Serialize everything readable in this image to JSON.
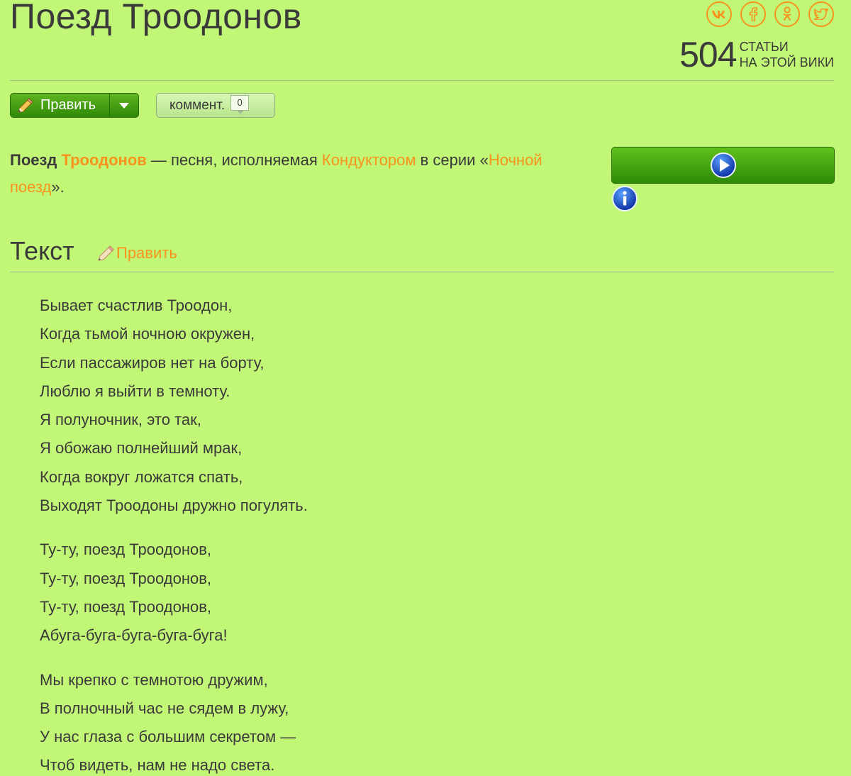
{
  "page": {
    "title": "Поезд Троодонов"
  },
  "social": [
    {
      "name": "vk",
      "label": "vk"
    },
    {
      "name": "facebook",
      "label": "f"
    },
    {
      "name": "odnoklassniki",
      "label": "ok"
    },
    {
      "name": "twitter",
      "label": "tw"
    }
  ],
  "wiki": {
    "count": "504",
    "label_line1": "СТАТЬИ",
    "label_line2": "НА ЭТОЙ ВИКИ"
  },
  "toolbar": {
    "edit_label": "Править",
    "comment_label": "коммент.",
    "comment_count": "0"
  },
  "intro": {
    "part1": "Поезд ",
    "link1": "Троодонов",
    "part2": " — песня, исполняемая ",
    "link2": "Кондуктором",
    "part3": " в серии «",
    "link3": "Ночной поезд",
    "part4": "»."
  },
  "section": {
    "title": "Текст",
    "edit_label": "Править"
  },
  "lyrics": {
    "stanza1": [
      "Бывает счастлив Троодон,",
      "Когда тьмой ночною окружен,",
      "Если пассажиров нет на борту,",
      "Люблю я выйти в темноту.",
      "Я полуночник, это так,",
      "Я обожаю полнейший мрак,",
      "Когда вокруг ложатся спать,",
      "Выходят Троодоны дружно погулять."
    ],
    "stanza2": [
      "Ту-ту, поезд Троодонов,",
      "Ту-ту, поезд Троодонов,",
      "Ту-ту, поезд Троодонов,",
      "Абуга-буга-буга-буга-буга!"
    ],
    "stanza3": [
      "Мы крепко с темнотою дружим,",
      "В полночный час не сядем в лужу,",
      "У нас глаза с большим секретом —",
      "Чтоб видеть, нам не надо света."
    ]
  },
  "colors": {
    "background": "#c2f677",
    "accent_link": "#f7941d",
    "button_green": "#2f8a07",
    "text": "#3a3a3a"
  }
}
